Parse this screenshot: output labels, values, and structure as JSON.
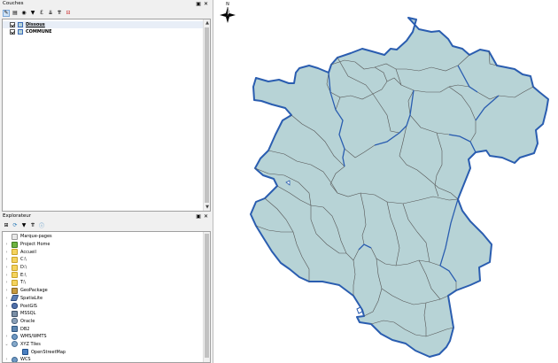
{
  "layers_panel": {
    "title": "Couches",
    "layers": [
      {
        "name": "Dissous",
        "checked": true
      },
      {
        "name": "COMMUNE",
        "checked": true
      }
    ]
  },
  "explorer_panel": {
    "title": "Explorateur",
    "items": [
      {
        "label": "Marque-pages",
        "icon": "bookmark-icon",
        "expander": ""
      },
      {
        "label": "Project Home",
        "icon": "home-icon",
        "expander": "›"
      },
      {
        "label": "Accueil",
        "icon": "folder-icon",
        "expander": "›"
      },
      {
        "label": "C:\\",
        "icon": "folder-icon",
        "expander": "›"
      },
      {
        "label": "D:\\",
        "icon": "folder-icon",
        "expander": "›"
      },
      {
        "label": "E:\\",
        "icon": "folder-icon",
        "expander": "›"
      },
      {
        "label": "T:\\",
        "icon": "folder-icon",
        "expander": "›"
      },
      {
        "label": "GeoPackage",
        "icon": "geopackage-icon",
        "expander": "›"
      },
      {
        "label": "SpatiaLite",
        "icon": "spatialite-icon",
        "expander": "›"
      },
      {
        "label": "PostGIS",
        "icon": "postgis-icon",
        "expander": "›"
      },
      {
        "label": "MSSQL",
        "icon": "mssql-icon",
        "expander": ""
      },
      {
        "label": "Oracle",
        "icon": "oracle-icon",
        "expander": ""
      },
      {
        "label": "DB2",
        "icon": "db2-icon",
        "expander": ""
      },
      {
        "label": "WMS/WMTS",
        "icon": "wms-icon",
        "expander": "›"
      },
      {
        "label": "XYZ Tiles",
        "icon": "xyz-tiles-icon",
        "expander": "⌄"
      },
      {
        "label": "OpenStreetMap",
        "icon": "openstreetmap-icon",
        "expander": "",
        "indent": true
      },
      {
        "label": "WCS",
        "icon": "wms-icon",
        "expander": "›"
      }
    ]
  },
  "map": {
    "north_label": "N",
    "fill_color": "#b7d3d6",
    "outline_color": "#2a5db0",
    "commune_line_color": "#555555"
  }
}
